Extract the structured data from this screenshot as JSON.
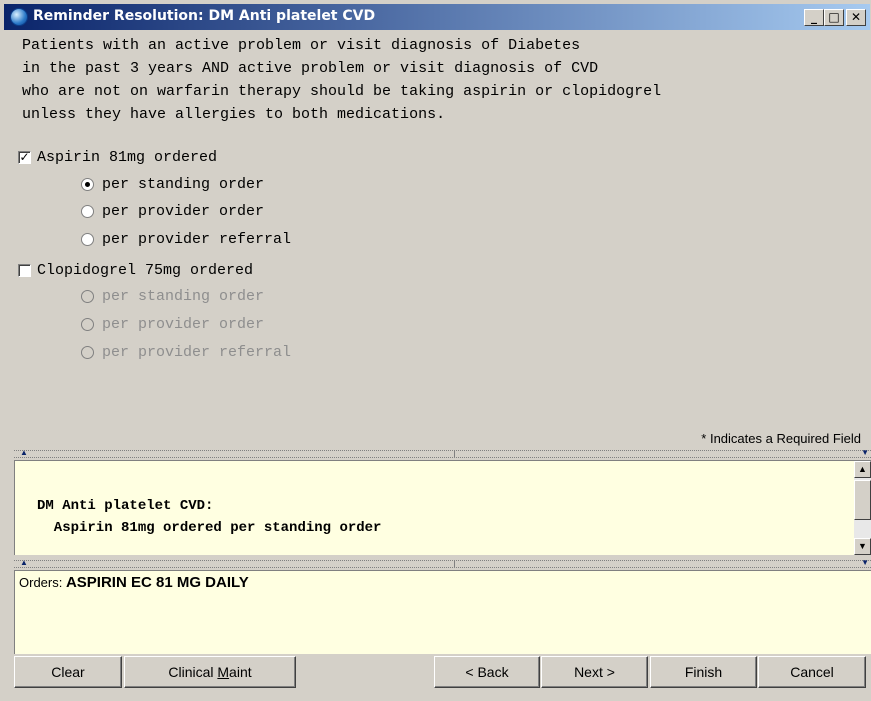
{
  "window": {
    "title": "Reminder Resolution: DM Anti platelet CVD",
    "controls": {
      "minimize": "_",
      "maximize": "□",
      "close": "✕"
    }
  },
  "description": "Patients with an active problem or visit diagnosis of Diabetes\nin the past 3 years AND active problem or visit diagnosis of CVD\nwho are not on warfarin therapy should be taking aspirin or clopidogrel\nunless they have allergies to both medications.",
  "aspirin": {
    "label": "Aspirin 81mg ordered",
    "checked": true,
    "options": [
      {
        "label": "per standing order",
        "selected": true
      },
      {
        "label": "per provider order",
        "selected": false
      },
      {
        "label": "per provider referral",
        "selected": false
      }
    ]
  },
  "clopidogrel": {
    "label": "Clopidogrel 75mg ordered",
    "checked": false,
    "options": [
      {
        "label": "per standing order",
        "selected": false
      },
      {
        "label": "per provider order",
        "selected": false
      },
      {
        "label": "per provider referral",
        "selected": false
      }
    ]
  },
  "required_note": "* Indicates a Required Field",
  "preview": {
    "line1": "DM Anti platelet CVD:",
    "line2": "  Aspirin 81mg ordered per standing order"
  },
  "orders": {
    "prefix": "Orders: ",
    "value": "ASPIRIN EC 81 MG DAILY"
  },
  "buttons": {
    "clear": "Clear",
    "clinical_maint": "Clinical Maint",
    "back": "< Back",
    "next": "Next >",
    "finish": "Finish",
    "cancel": "Cancel"
  },
  "colors": {
    "title_start": "#0a246a",
    "title_end": "#a6caf0",
    "panel_bg": "#ffffe1",
    "face": "#d4d0c8"
  }
}
